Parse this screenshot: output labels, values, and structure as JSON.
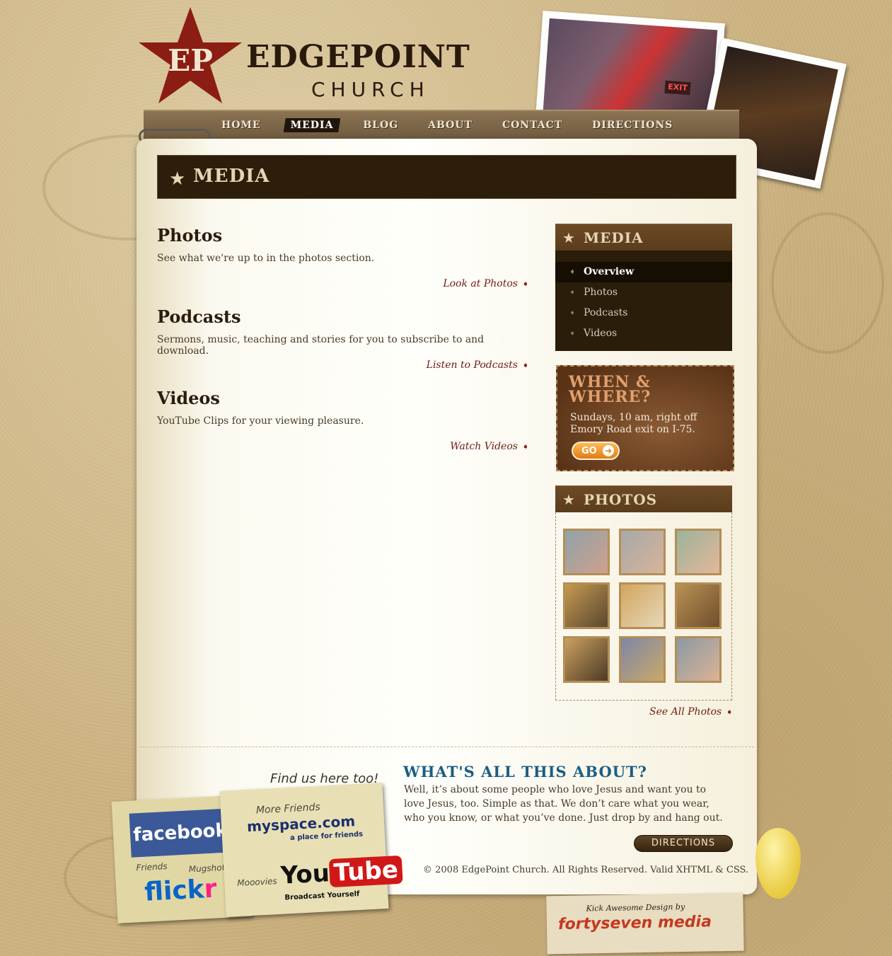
{
  "header": {
    "logo_monogram": "EP",
    "title": "EDGEPOINT",
    "subtitle": "CHURCH",
    "photo_sign": "EXIT"
  },
  "nav": {
    "items": [
      "HOME",
      "MEDIA",
      "BLOG",
      "ABOUT",
      "CONTACT",
      "DIRECTIONS"
    ],
    "active": "MEDIA"
  },
  "page": {
    "title": "MEDIA"
  },
  "sections": [
    {
      "title": "Photos",
      "text": "See what we're up to in the photos section.",
      "link": "Look at Photos"
    },
    {
      "title": "Podcasts",
      "text": "Sermons, music, teaching and stories for you to subscribe to and download.",
      "link": "Listen to Podcasts"
    },
    {
      "title": "Videos",
      "text": "YouTube Clips for your viewing pleasure.",
      "link": "Watch Videos"
    }
  ],
  "sidebar": {
    "media_title": "MEDIA",
    "menu": [
      {
        "label": "Overview",
        "active": true
      },
      {
        "label": "Photos",
        "active": false
      },
      {
        "label": "Podcasts",
        "active": false
      },
      {
        "label": "Videos",
        "active": false
      }
    ],
    "when_title_1": "WHEN &",
    "when_title_2": "WHERE?",
    "when_text": "Sundays, 10 am, right off Emory Road exit on I-75.",
    "go_label": "GO",
    "photos_title": "PHOTOS",
    "see_all": "See All Photos"
  },
  "footer": {
    "about_title": "WHAT'S ALL THIS ABOUT?",
    "about_text": "Well, it’s about some people who love Jesus and want you to love Jesus, too. Simple as that. We don’t care what you wear, who you know, or what you’ve done. Just drop by and hang out.",
    "directions_label": "DIRECTIONS",
    "copyright": "© 2008 EdgePoint Church. All Rights Reserved. Valid XHTML & CSS.",
    "find_us": "Find us here too!",
    "more_friends": "More Friends",
    "friends": "Friends",
    "mugshots": "Mugshots",
    "mooovies": "Mooovies",
    "facebook": "facebook",
    "flickr_main": "flick",
    "flickr_r": "r",
    "myspace": "myspace.com",
    "myspace_tag": "a place for friends",
    "youtube_you": "You",
    "youtube_tube": "Tube",
    "youtube_tag": "Broadcast Yourself",
    "credit_small": "Kick Awesome Design by",
    "credit_main": "fortyseven media"
  },
  "colors": {
    "accent_dark": "#2c1e0b",
    "link": "#6e1d12",
    "about_blue": "#1c5e84",
    "go_orange": "#e47a14"
  }
}
